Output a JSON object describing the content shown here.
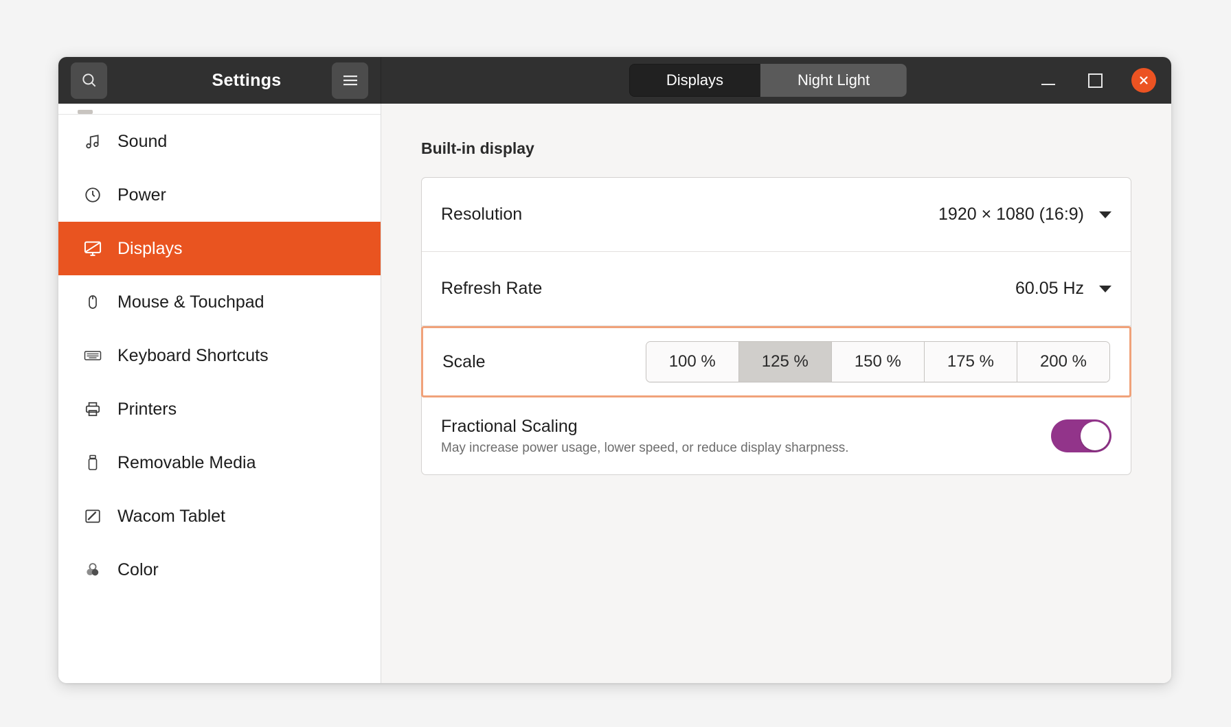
{
  "window": {
    "title": "Settings",
    "search_icon": "search-icon",
    "menu_icon": "hamburger-menu-icon",
    "minimize_label": "",
    "maximize_label": "",
    "close_label": "",
    "accent_orange": "#e95420",
    "titlebar_bg": "#303030"
  },
  "tabs": [
    {
      "label": "Displays",
      "active": true
    },
    {
      "label": "Night Light",
      "active": false
    }
  ],
  "sidebar": {
    "items": [
      {
        "label": "Sound",
        "icon": "music-note-icon",
        "active": false
      },
      {
        "label": "Power",
        "icon": "power-clock-icon",
        "active": false
      },
      {
        "label": "Displays",
        "icon": "monitor-icon",
        "active": true
      },
      {
        "label": "Mouse & Touchpad",
        "icon": "mouse-icon",
        "active": false
      },
      {
        "label": "Keyboard Shortcuts",
        "icon": "keyboard-icon",
        "active": false
      },
      {
        "label": "Printers",
        "icon": "printer-icon",
        "active": false
      },
      {
        "label": "Removable Media",
        "icon": "usb-drive-icon",
        "active": false
      },
      {
        "label": "Wacom Tablet",
        "icon": "tablet-pen-icon",
        "active": false
      },
      {
        "label": "Color",
        "icon": "color-circles-icon",
        "active": false
      }
    ]
  },
  "main": {
    "section_title": "Built-in display",
    "resolution": {
      "label": "Resolution",
      "value": "1920 × 1080 (16:9)"
    },
    "refresh_rate": {
      "label": "Refresh Rate",
      "value": "60.05 Hz"
    },
    "scale": {
      "label": "Scale",
      "options": [
        {
          "label": "100 %",
          "selected": false
        },
        {
          "label": "125 %",
          "selected": true
        },
        {
          "label": "150 %",
          "selected": false
        },
        {
          "label": "175 %",
          "selected": false
        },
        {
          "label": "200 %",
          "selected": false
        }
      ],
      "focus_border_color": "#f0a27a"
    },
    "fractional_scaling": {
      "title": "Fractional Scaling",
      "subtitle": "May increase power usage, lower speed, or reduce display sharpness.",
      "enabled": true,
      "toggle_color": "#92348a"
    }
  }
}
